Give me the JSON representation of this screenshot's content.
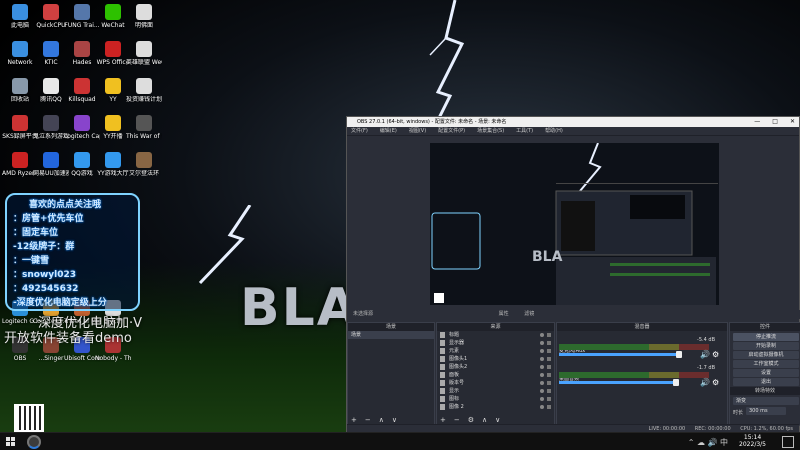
{
  "desktop": {
    "icons": [
      {
        "label": "此电脑",
        "col": 0,
        "row": 0,
        "color": "#3a8fe0"
      },
      {
        "label": "QuickCPU",
        "col": 1,
        "row": 0,
        "color": "#d04040"
      },
      {
        "label": "FUNG Trai...",
        "col": 2,
        "row": 0,
        "color": "#5577aa"
      },
      {
        "label": "WeChat",
        "col": 3,
        "row": 0,
        "color": "#2dc100"
      },
      {
        "label": "明佛面",
        "col": 4,
        "row": 0,
        "color": "#dddddd"
      },
      {
        "label": "Network",
        "col": 0,
        "row": 1,
        "color": "#3a8fe0"
      },
      {
        "label": "KTIC",
        "col": 1,
        "row": 1,
        "color": "#3377dd"
      },
      {
        "label": "Hades",
        "col": 2,
        "row": 1,
        "color": "#aa4444"
      },
      {
        "label": "WPS Office",
        "col": 3,
        "row": 1,
        "color": "#cc2222"
      },
      {
        "label": "英雄联盟 WeGame版",
        "col": 4,
        "row": 1,
        "color": "#dddddd"
      },
      {
        "label": "回收站",
        "col": 0,
        "row": 2,
        "color": "#8899aa"
      },
      {
        "label": "腾讯QQ",
        "col": 1,
        "row": 2,
        "color": "#e8e8e8"
      },
      {
        "label": "Killsquad",
        "col": 2,
        "row": 2,
        "color": "#cc3333"
      },
      {
        "label": "YY",
        "col": 3,
        "row": 2,
        "color": "#f0c020"
      },
      {
        "label": "投资赚钱计划 打工篇",
        "col": 4,
        "row": 2,
        "color": "#dddddd"
      },
      {
        "label": "SKS録屏平台",
        "col": 0,
        "row": 3,
        "color": "#cc3333"
      },
      {
        "label": "鬼泣系列游戏平台",
        "col": 1,
        "row": 3,
        "color": "#444455"
      },
      {
        "label": "Logitech Capture",
        "col": 2,
        "row": 3,
        "color": "#8844cc"
      },
      {
        "label": "YY开播",
        "col": 3,
        "row": 3,
        "color": "#f0c020"
      },
      {
        "label": "This War of Mine",
        "col": 4,
        "row": 3,
        "color": "#555555"
      },
      {
        "label": "AMD Ryzen Master",
        "col": 0,
        "row": 4,
        "color": "#cc2222"
      },
      {
        "label": "网易UU加速器",
        "col": 1,
        "row": 4,
        "color": "#2266dd"
      },
      {
        "label": "QQ游戏",
        "col": 2,
        "row": 4,
        "color": "#3399ee"
      },
      {
        "label": "YY游戏大厅",
        "col": 3,
        "row": 4,
        "color": "#3399ee"
      },
      {
        "label": "艾尔登法环",
        "col": 4,
        "row": 4,
        "color": "#886644"
      },
      {
        "label": "Logitech G HUB",
        "col": 0,
        "row": 8,
        "color": "#2a8fd8"
      },
      {
        "label": "Counter-S... Global Off...",
        "col": 1,
        "row": 8,
        "color": "#e0a030"
      },
      {
        "label": "Tribes of Midgard",
        "col": 2,
        "row": 8,
        "color": "#c06030"
      },
      {
        "label": "鲁花评",
        "col": 3,
        "row": 8,
        "color": "#dddddd"
      },
      {
        "label": "OBS",
        "col": 0,
        "row": 9,
        "color": "#333333"
      },
      {
        "label": "...Singer",
        "col": 1,
        "row": 9,
        "color": "#884433"
      },
      {
        "label": "Ubisoft Connect",
        "col": 2,
        "row": 9,
        "color": "#3355cc"
      },
      {
        "label": "Nobody - The Turna...",
        "col": 3,
        "row": 9,
        "color": "#aa3333"
      }
    ],
    "promo_lines": [
      "喜欢的点点关注哦",
      "：房管+优先车位",
      "：固定车位",
      "-12级牌子：群",
      "：一键雪",
      "：snowyl023",
      "：492545632",
      "-深度优化电脑定级上分"
    ],
    "watermark_line1": "深度优化电脑加·V",
    "watermark_line2": "开放软件装备看demo",
    "banner_text": "BLA"
  },
  "obs": {
    "title": "OBS 27.0.1 (64-bit, windows) - 配置文件: 未命名 - 场景: 未命名",
    "window_controls": [
      "—",
      "□",
      "✕"
    ],
    "menu": [
      "文件(F)",
      "编辑(E)",
      "视图(V)",
      "配置文件(P)",
      "场景集合(S)",
      "工具(T)",
      "帮助(H)"
    ],
    "status_source": "未选择源",
    "status_props": "属性",
    "status_filters": "滤镜",
    "scenes_title": "场景",
    "scenes": [
      "场景"
    ],
    "sources_title": "来源",
    "sources": [
      "标题",
      "显示器",
      "元素",
      "图像头1",
      "图像头2",
      "面板",
      "版本号",
      "显示",
      "图标",
      "图像 2"
    ],
    "mixer_title": "混音器",
    "channels": [
      {
        "name": "麦克风/Aux",
        "db": "-5.4 dB",
        "level": 0.92
      },
      {
        "name": "桌面音频",
        "db": "-1.7 dB",
        "level": 0.9
      }
    ],
    "controls_title": "控件",
    "controls": [
      "停止推流",
      "开始录制",
      "启动虚拟摄像机",
      "工作室模式",
      "设置",
      "退出"
    ],
    "transitions_title": "转场特效",
    "transition_type": "渐变",
    "duration_label": "时长",
    "duration_value": "300 ms",
    "statusbar": [
      "LIVE: 00:00:00",
      "REC: 00:00:00",
      "CPU: 1.2%, 60.00 fps"
    ]
  },
  "taskbar": {
    "time": "15:14",
    "date": "2022/3/5",
    "tray_icons": "⌃ ☁ 🔊 中"
  }
}
